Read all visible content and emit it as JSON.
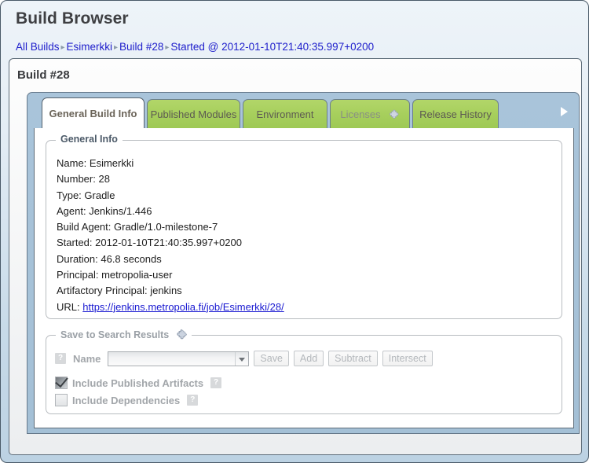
{
  "header": {
    "title": "Build Browser",
    "breadcrumb": [
      {
        "label": "All Builds"
      },
      {
        "label": "Esimerkki"
      },
      {
        "label": "Build #28"
      },
      {
        "label": "Started @ 2012-01-10T21:40:35.997+0200"
      }
    ],
    "separator": "▸"
  },
  "card": {
    "heading": "Build #28"
  },
  "tabs": {
    "items": [
      {
        "label": "General Build Info",
        "active": true,
        "disabled": false,
        "icon": null
      },
      {
        "label": "Published Modules",
        "active": false,
        "disabled": false,
        "icon": null
      },
      {
        "label": "Environment",
        "active": false,
        "disabled": false,
        "icon": null
      },
      {
        "label": "Licenses",
        "active": false,
        "disabled": true,
        "icon": "puzzle-icon"
      },
      {
        "label": "Release History",
        "active": false,
        "disabled": false,
        "icon": null
      }
    ],
    "next_arrow_icon": "chevron-right-icon"
  },
  "general_info": {
    "legend": "General Info",
    "rows": [
      {
        "label": "Name:",
        "value": "Esimerkki"
      },
      {
        "label": "Number:",
        "value": "28"
      },
      {
        "label": "Type:",
        "value": "Gradle"
      },
      {
        "label": "Agent:",
        "value": "Jenkins/1.446"
      },
      {
        "label": "Build Agent:",
        "value": "Gradle/1.0-milestone-7"
      },
      {
        "label": "Started:",
        "value": "2012-01-10T21:40:35.997+0200"
      },
      {
        "label": "Duration:",
        "value": "46.8 seconds"
      },
      {
        "label": "Principal:",
        "value": "metropolia-user"
      },
      {
        "label": "Artifactory Principal:",
        "value": "jenkins"
      }
    ],
    "url_label": "URL:",
    "url_text": "https://jenkins.metropolia.fi/job/Esimerkki/28/"
  },
  "save_search": {
    "legend": "Save to Search Results",
    "legend_icon": "puzzle-icon",
    "help_badge": "?",
    "name_label": "Name",
    "name_value": "",
    "name_placeholder": "",
    "buttons": [
      {
        "label": "Save",
        "disabled": true
      },
      {
        "label": "Add",
        "disabled": true
      },
      {
        "label": "Subtract",
        "disabled": true
      },
      {
        "label": "Intersect",
        "disabled": true
      }
    ],
    "checkboxes": [
      {
        "label": "Include Published Artifacts",
        "checked": true,
        "help": "?"
      },
      {
        "label": "Include Dependencies",
        "checked": false,
        "help": "?"
      }
    ]
  },
  "colors": {
    "tab_green": "#a7cf5d",
    "link_blue": "#2020cc",
    "panel_blue_gray": "#a7c2d8",
    "muted_text": "#a2a6aa"
  }
}
